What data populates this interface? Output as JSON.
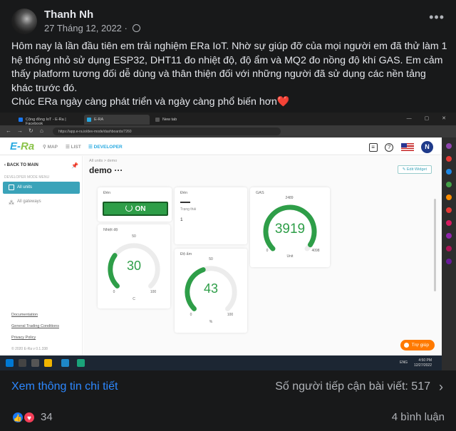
{
  "post": {
    "author": "Thanh Nh",
    "date": "27 Tháng 12, 2022",
    "privacy_icon": "globe-icon",
    "more_icon": "more-options-icon",
    "lines": [
      "Hôm nay là lần đầu tiên em trải nghiệm ERa IoT. Nhờ sự giúp đỡ của mọi người em đã thử làm 1",
      "hệ thống nhỏ sử dụng ESP32, DHT11 đo nhiệt độ, độ ẩm và MQ2 đo nồng độ khí GAS. Em cảm",
      "thấy platform tương đối dễ dùng và thân thiện đối với những người đã sử dụng các nền tảng",
      "khác trước đó."
    ],
    "closing": "Chúc ERa ngày càng phát triển và ngày càng phổ biến hơn",
    "closing_emoji": "❤️"
  },
  "browser": {
    "tabs": [
      {
        "label": "Cộng đồng IoT - E-Ra | Facebook",
        "color": "#1877f2"
      },
      {
        "label": "E-RA",
        "color": "#27a9e1"
      },
      {
        "label": "New tab",
        "color": "#666666"
      }
    ],
    "url": "https://app.e-ra.io/dev-mode/dashboards/7260",
    "window_controls": "— ▢ ✕"
  },
  "app": {
    "logo_main": "E-",
    "logo_accent": "Ra",
    "nav": {
      "map": "MAP",
      "list": "LIST",
      "developer": "DEVELOPER"
    },
    "user_initial": "N",
    "sidebar": {
      "back": "BACK TO MAIN",
      "section": "DEVELOPER MODE MENU",
      "all_units": "All units",
      "all_gateways": "All gateways",
      "links": [
        "Documentation",
        "General Trading Conditions",
        "Privacy Policy"
      ],
      "copyright": "© 2020 E-Ra v 0.1.338"
    },
    "breadcrumb": "All units  >  demo",
    "dashboard_title": "demo",
    "dashboard_menu": "···",
    "edit_widget": "Edit Widget",
    "help_button": "Trợ giúp"
  },
  "widgets": {
    "switch": {
      "label": "Đèn",
      "state": "ON"
    },
    "lamp_value": {
      "label": "Đèn",
      "sublabel": "Trạng thái",
      "value": "1"
    },
    "temperature": {
      "label": "Nhiệt độ",
      "value": "30",
      "min": "0",
      "max": "100",
      "mid": "50",
      "unit": "C",
      "fraction": 0.3
    },
    "humidity": {
      "label": "Độ ẩm",
      "value": "43",
      "min": "0",
      "max": "100",
      "mid": "50",
      "unit": "%",
      "fraction": 0.43
    },
    "gas": {
      "label": "GAS",
      "value": "3919",
      "min": "0",
      "max": "4098",
      "mid": "2489",
      "unit": "Unit",
      "fraction": 0.956
    }
  },
  "taskbar": {
    "time": "4:50 PM",
    "date": "12/27/2022",
    "lang": "ENG"
  },
  "footer": {
    "see_more": "Xem thông tin chi tiết",
    "reach": "Số người tiếp cận bài viết: 517",
    "reaction_count": "34",
    "comments": "4 bình luận"
  },
  "colors": {
    "background": "#18191a",
    "link": "#2d88ff",
    "era_blue": "#27a9e1",
    "gauge_green": "#2e9e48",
    "help_orange": "#ff7a00"
  }
}
